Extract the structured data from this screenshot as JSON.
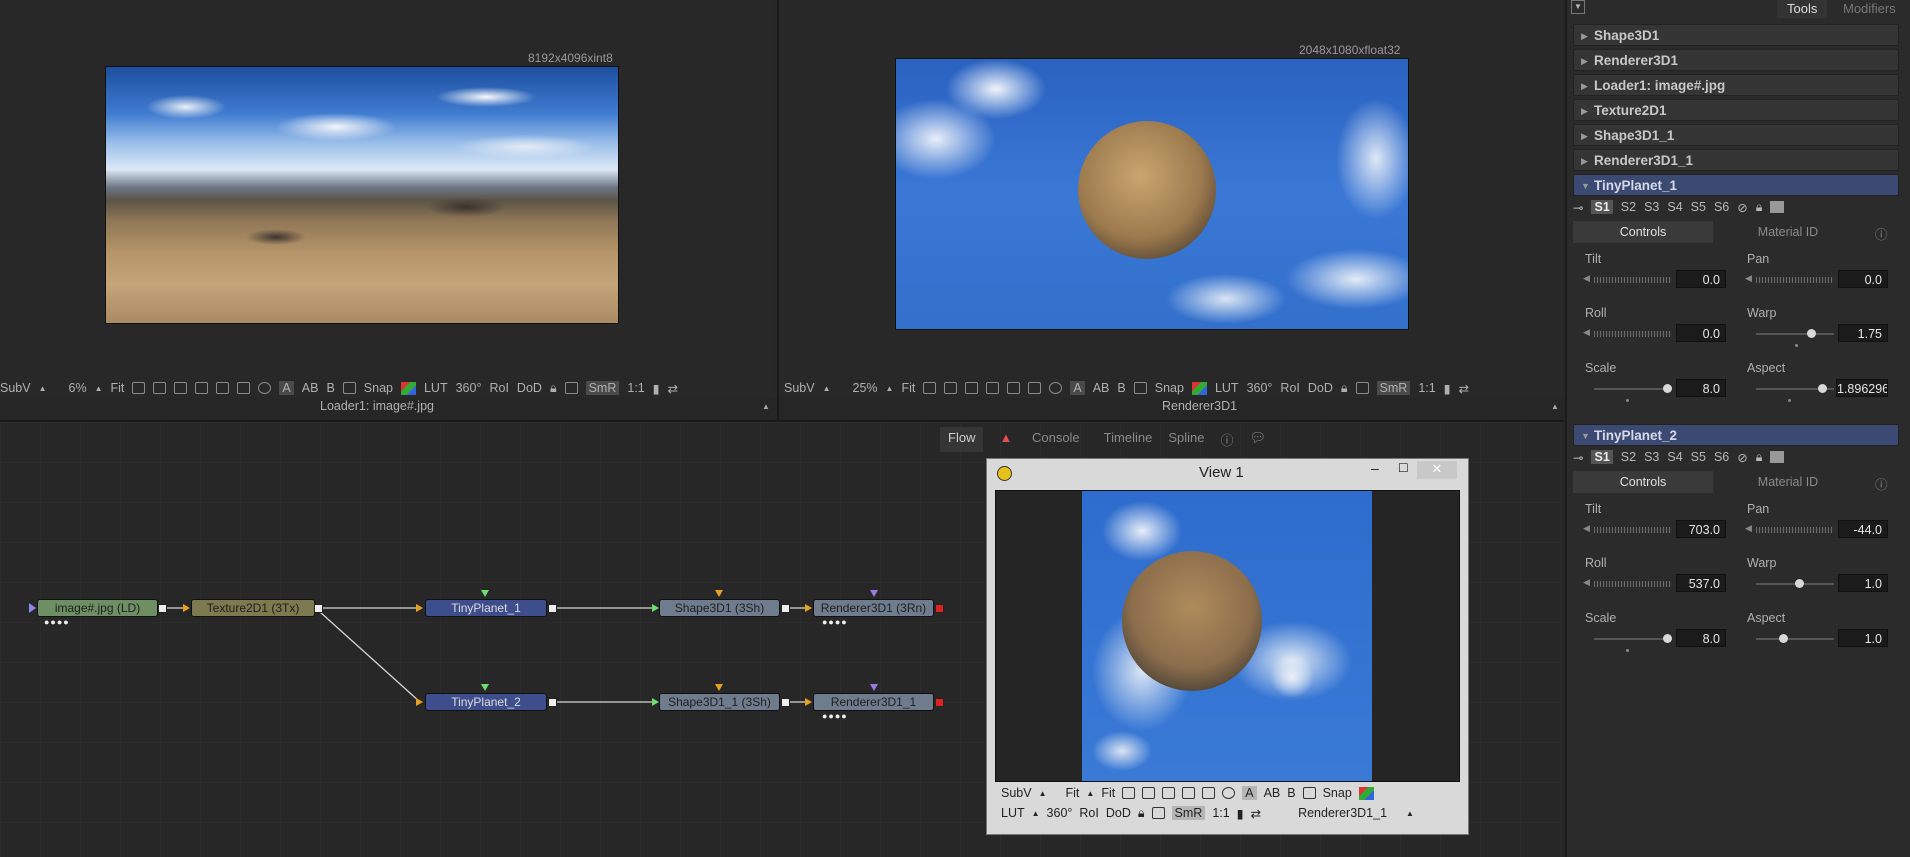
{
  "viewer_left": {
    "resolution": "8192x4096xint8",
    "label": "Loader1: image#.jpg",
    "toolbar": [
      "SubV",
      "6%",
      "Fit",
      "A",
      "B",
      "Snap",
      "LUT",
      "360°",
      "RoI",
      "DoD",
      "SmR",
      "1:1"
    ]
  },
  "viewer_right": {
    "resolution": "2048x1080xfloat32",
    "label": "Renderer3D1",
    "toolbar": [
      "SubV",
      "25%",
      "Fit",
      "A",
      "B",
      "Snap",
      "LUT",
      "360°",
      "RoI",
      "DoD",
      "SmR",
      "1:1"
    ]
  },
  "flow_tabs": [
    "Flow",
    "Console",
    "Timeline",
    "Spline"
  ],
  "nodes": {
    "loader": "image#.jpg  (LD)",
    "texture": "Texture2D1  (3Tx)",
    "tiny1": "TinyPlanet_1",
    "tiny2": "TinyPlanet_2",
    "shape1": "Shape3D1  (3Sh)",
    "shape2": "Shape3D1_1  (3Sh)",
    "render1": "Renderer3D1  (3Rn)",
    "render2": "Renderer3D1_1"
  },
  "view_window": {
    "title": "View 1",
    "toolbar_row1": [
      "SubV",
      "Fit",
      "Fit",
      "A",
      "B",
      "Snap"
    ],
    "toolbar_row2": [
      "LUT",
      "360°",
      "RoI",
      "DoD",
      "SmR",
      "1:1"
    ],
    "label": "Renderer3D1_1"
  },
  "panel": {
    "tabs": [
      "Tools",
      "Modifiers"
    ],
    "collapsed_tools": [
      "Shape3D1",
      "Renderer3D1",
      "Loader1: image#.jpg",
      "Texture2D1",
      "Shape3D1_1",
      "Renderer3D1_1"
    ],
    "slots": [
      "S1",
      "S2",
      "S3",
      "S4",
      "S5",
      "S6"
    ],
    "control_tabs": [
      "Controls",
      "Material ID"
    ],
    "tool1": {
      "name": "TinyPlanet_1",
      "tilt_label": "Tilt",
      "tilt": "0.0",
      "pan_label": "Pan",
      "pan": "0.0",
      "roll_label": "Roll",
      "roll": "0.0",
      "warp_label": "Warp",
      "warp": "1.75",
      "scale_label": "Scale",
      "scale": "8.0",
      "aspect_label": "Aspect",
      "aspect": "1.896296"
    },
    "tool2": {
      "name": "TinyPlanet_2",
      "tilt_label": "Tilt",
      "tilt": "703.0",
      "pan_label": "Pan",
      "pan": "-44.0",
      "roll_label": "Roll",
      "roll": "537.0",
      "warp_label": "Warp",
      "warp": "1.0",
      "scale_label": "Scale",
      "scale": "8.0",
      "aspect_label": "Aspect",
      "aspect": "1.0"
    }
  },
  "colors": {
    "accent_blue": "#3a4a72",
    "node_blue": "#3e4d8c",
    "link_yellow": "#e8a020"
  }
}
